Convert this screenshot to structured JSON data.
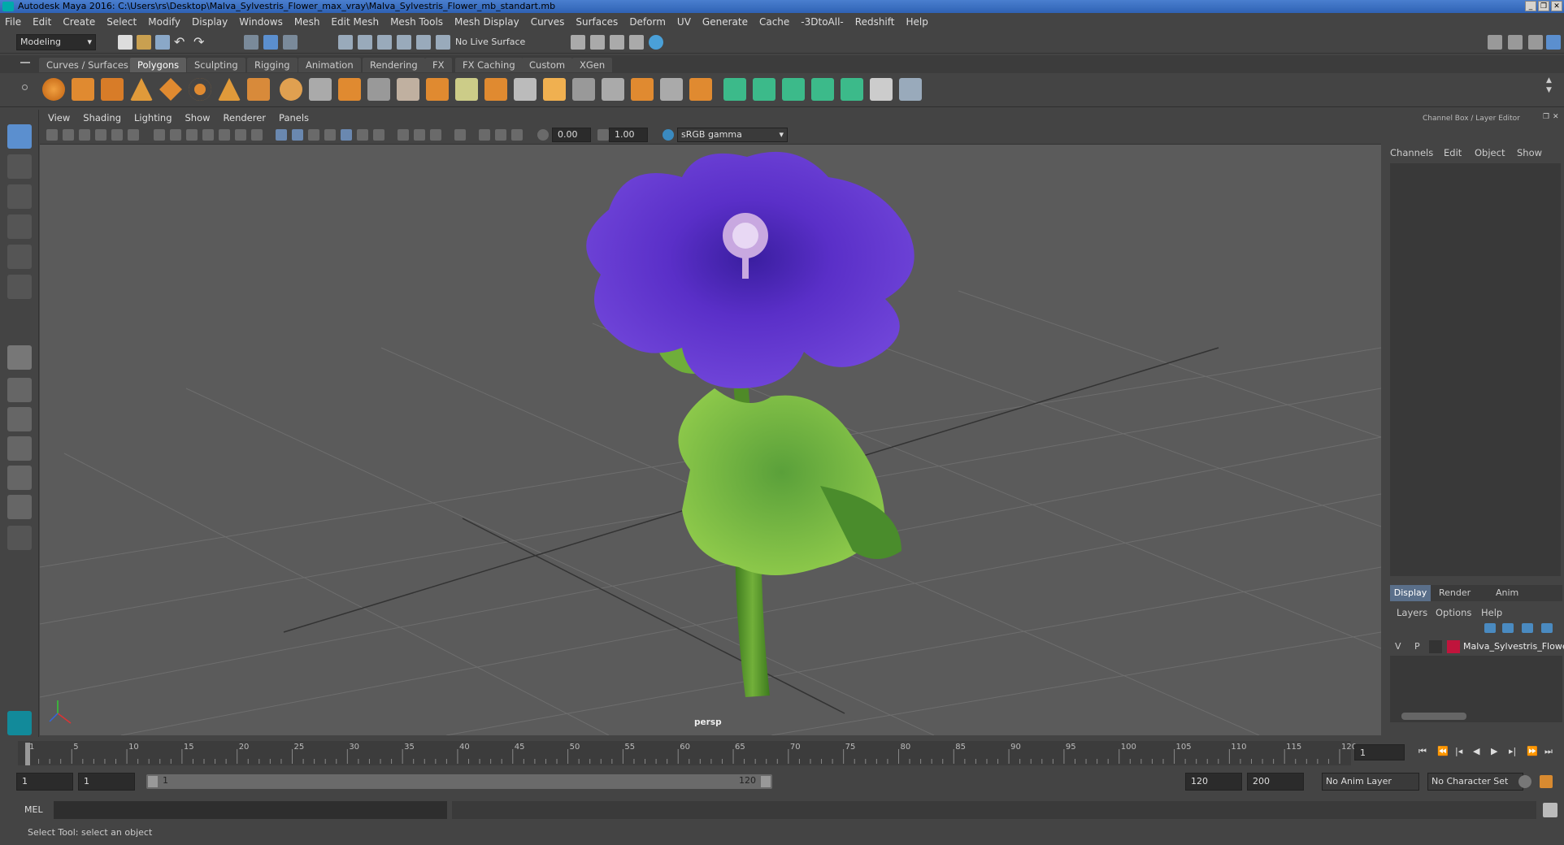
{
  "window": {
    "title": "Autodesk Maya 2016: C:\\Users\\rs\\Desktop\\Malva_Sylvestris_Flower_max_vray\\Malva_Sylvestris_Flower_mb_standart.mb"
  },
  "menubar": [
    "File",
    "Edit",
    "Create",
    "Select",
    "Modify",
    "Display",
    "Windows",
    "Mesh",
    "Edit Mesh",
    "Mesh Tools",
    "Mesh Display",
    "Curves",
    "Surfaces",
    "Deform",
    "UV",
    "Generate",
    "Cache",
    "-3DtoAll-",
    "Redshift",
    "Help"
  ],
  "status": {
    "mode": "Modeling",
    "live_surface": "No Live Surface"
  },
  "shelf_tabs": [
    "Curves / Surfaces",
    "Polygons",
    "Sculpting",
    "Rigging",
    "Animation",
    "Rendering",
    "FX",
    "FX Caching",
    "Custom",
    "XGen"
  ],
  "viewport": {
    "menu": [
      "View",
      "Shading",
      "Lighting",
      "Show",
      "Renderer",
      "Panels"
    ],
    "exposure": "0.00",
    "gamma": "1.00",
    "color_space": "sRGB gamma",
    "camera_label": "persp"
  },
  "channel_box": {
    "title": "Channel Box / Layer Editor",
    "menu": [
      "Channels",
      "Edit",
      "Object",
      "Show"
    ]
  },
  "layer_editor": {
    "tabs": [
      "Display",
      "Render",
      "Anim"
    ],
    "menu": [
      "Layers",
      "Options",
      "Help"
    ],
    "layer": {
      "v": "V",
      "p": "P",
      "name": "Malva_Sylvestris_Flowe",
      "color": "#c0143c"
    }
  },
  "timeline": {
    "ticks": [
      "1",
      "5",
      "10",
      "15",
      "20",
      "25",
      "30",
      "35",
      "40",
      "45",
      "50",
      "55",
      "60",
      "65",
      "70",
      "75",
      "80",
      "85",
      "90",
      "95",
      "100",
      "105",
      "110",
      "115",
      "120"
    ],
    "current_frame": "1"
  },
  "range": {
    "start": "1",
    "playback_start": "1",
    "range_start_label": "1",
    "range_end_label": "120",
    "playback_end": "120",
    "end": "200",
    "anim_layer": "No Anim Layer",
    "character_set": "No Character Set"
  },
  "cmdline": {
    "label": "MEL"
  },
  "help": {
    "text": "Select Tool: select an object"
  }
}
